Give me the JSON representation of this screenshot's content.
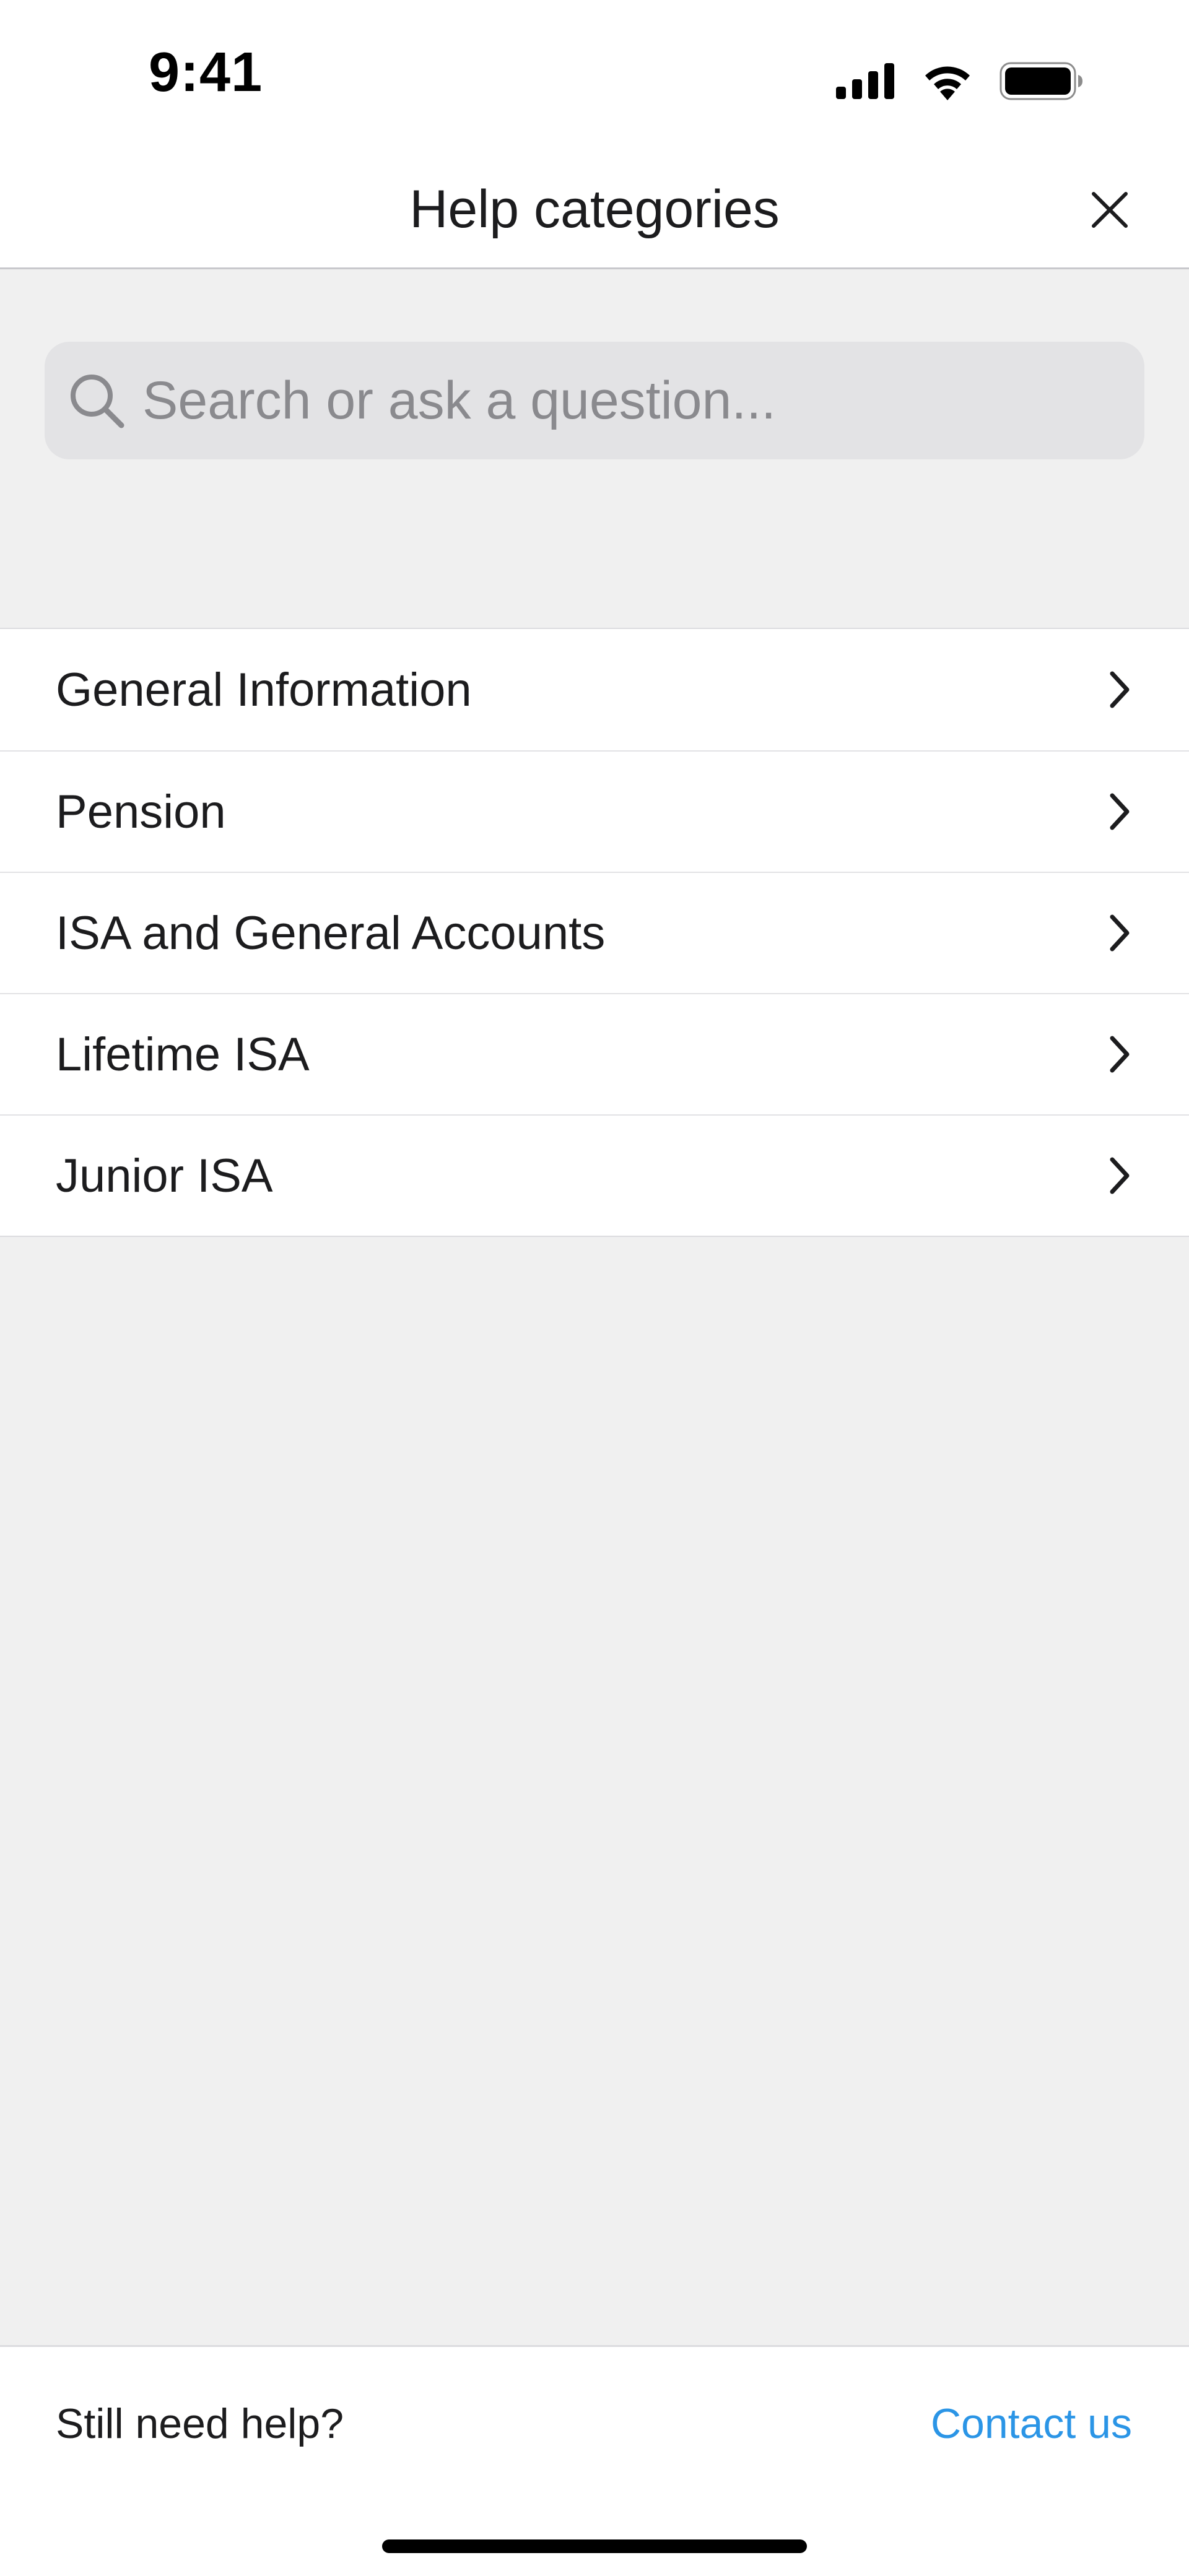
{
  "status_bar": {
    "time": "9:41",
    "icons": [
      "cellular-signal-icon",
      "wifi-icon",
      "battery-icon"
    ]
  },
  "header": {
    "title": "Help categories",
    "close_icon": "close-icon"
  },
  "search": {
    "placeholder": "Search or ask a question...",
    "value": "",
    "icon": "search-icon"
  },
  "categories": [
    {
      "label": "General Information"
    },
    {
      "label": "Pension"
    },
    {
      "label": "ISA and General Accounts"
    },
    {
      "label": "Lifetime ISA"
    },
    {
      "label": "Junior ISA"
    }
  ],
  "footer": {
    "prompt": "Still need help?",
    "contact_label": "Contact us"
  },
  "colors": {
    "background": "#f0f0f0",
    "surface": "#ffffff",
    "search_field": "#e3e3e5",
    "link": "#2b95e6",
    "text": "#1c1c1e"
  }
}
